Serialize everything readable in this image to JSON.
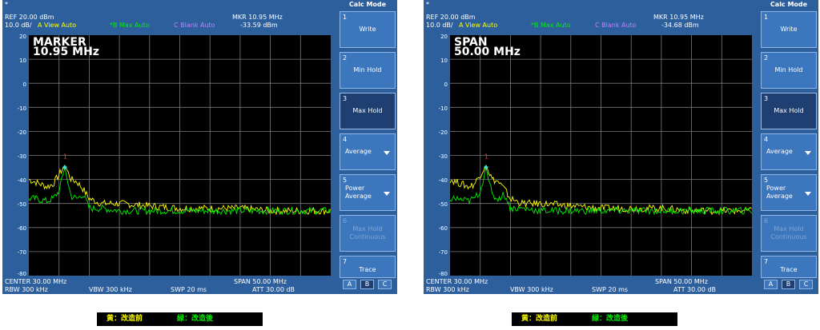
{
  "panels": [
    {
      "ref": "REF  20.00 dBm",
      "scale": "10.0 dB/",
      "trace_a": "A View Auto",
      "trace_b": "*B Max Auto",
      "trace_c": "C Blank Auto",
      "mkr_label": "MKR 10.95 MHz",
      "mkr_value": "-33.59 dBm",
      "overlay_line1": "MARKER",
      "overlay_line2": "10.95 MHz",
      "center": "CENTER 30.00 MHz",
      "span": "SPAN 50.00 MHz",
      "rbw": "RBW 300 kHz",
      "vbw": "VBW  300 kHz",
      "swp": "SWP  20 ms",
      "att": "ATT  30.00 dB"
    },
    {
      "ref": "REF  20.00 dBm",
      "scale": "10.0 dB/",
      "trace_a": "A View Auto",
      "trace_b": "*B Max Auto",
      "trace_c": "C Blank Auto",
      "mkr_label": "MKR 10.95 MHz",
      "mkr_value": "-34.68 dBm",
      "overlay_line1": "SPAN",
      "overlay_line2": "50.00 MHz",
      "center": "CENTER 30.00 MHz",
      "span": "SPAN 50.00 MHz",
      "rbw": "RBW 300 kHz",
      "vbw": "VBW  300 kHz",
      "swp": "SWP  20 ms",
      "att": "ATT  30.00 dB"
    }
  ],
  "y_ticks": [
    "20",
    "10",
    "0",
    "-10",
    "-20",
    "-30",
    "-40",
    "-50",
    "-60",
    "-70",
    "-80"
  ],
  "marker_number": "1",
  "menu": {
    "title": "Calc Mode",
    "star": "*",
    "items": [
      {
        "num": "1",
        "label": "Write"
      },
      {
        "num": "2",
        "label": "Min Hold"
      },
      {
        "num": "3",
        "label": "Max Hold"
      },
      {
        "num": "4",
        "label": "Average"
      },
      {
        "num": "5",
        "label": "Power\nAverage"
      },
      {
        "num": "6",
        "label": "Max Hold\nContinuous"
      },
      {
        "num": "7",
        "label": "Trace"
      }
    ],
    "trace_buttons": [
      "A",
      "B",
      "C"
    ]
  },
  "legend": {
    "yellow": "黄：改造前",
    "green": "緑：改造後"
  },
  "colors": {
    "panel": "#2d5f9d",
    "key": "#3c76bc",
    "key_active": "#1f3f72",
    "trace_before": "#ffff00",
    "trace_after": "#00ee00",
    "marker": "#40e0d0",
    "marker_num": "#ff3030"
  },
  "chart_data": {
    "type": "line",
    "x_unit": "MHz",
    "y_unit": "dBm",
    "xlim": [
      5,
      55
    ],
    "ylim": [
      -80,
      20
    ],
    "series": [
      {
        "name": "黄：改造前",
        "x": [
          5,
          6,
          8,
          9,
          10,
          10.95,
          12,
          13,
          14,
          15,
          17,
          20,
          25,
          30,
          35,
          40,
          45,
          50,
          55
        ],
        "y": [
          -40,
          -41,
          -43,
          -42,
          -38,
          -34,
          -40,
          -41,
          -44,
          -48,
          -50,
          -50,
          -51,
          -52,
          -52,
          -52,
          -53,
          -53,
          -53
        ]
      },
      {
        "name": "緑：改造後",
        "x": [
          5,
          6,
          8,
          9,
          10,
          10.95,
          12,
          13,
          14,
          15,
          17,
          20,
          25,
          30,
          35,
          40,
          45,
          50,
          55
        ],
        "y": [
          -48,
          -48,
          -49,
          -48,
          -45,
          -35,
          -47,
          -48,
          -46,
          -52,
          -52,
          -53,
          -53,
          -53,
          -53,
          -53,
          -53,
          -53,
          -53
        ]
      }
    ]
  }
}
